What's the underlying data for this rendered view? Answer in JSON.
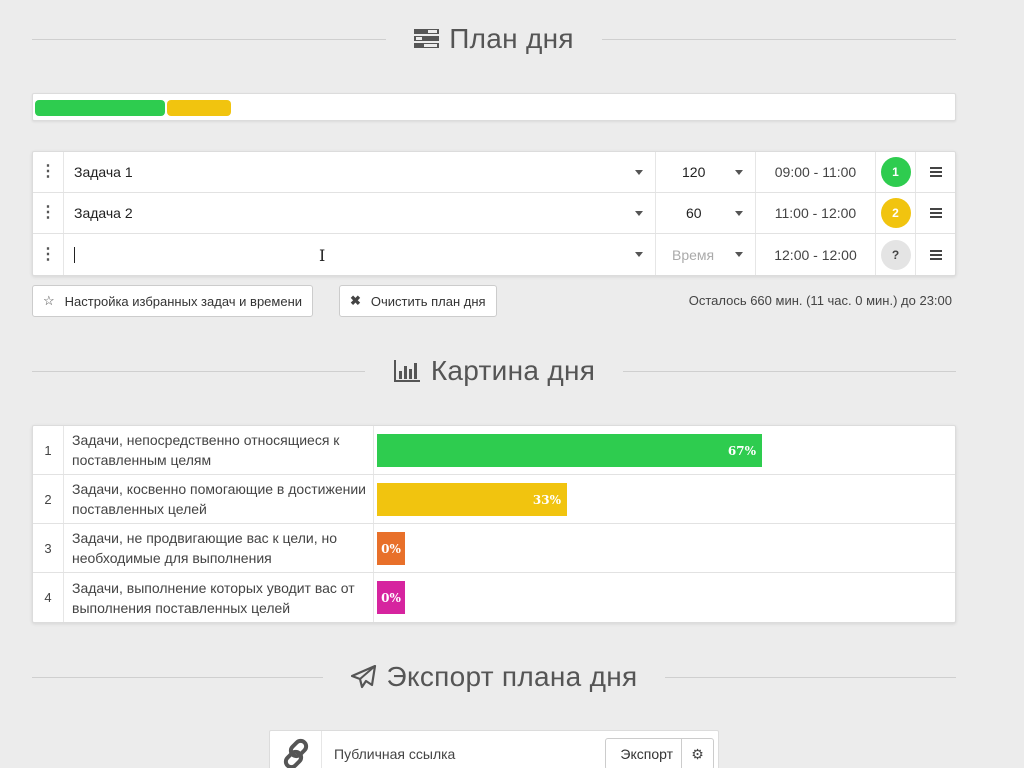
{
  "plan_section": {
    "title": "План дня",
    "icon": "tasks-list-icon"
  },
  "progress": {
    "segments": [
      {
        "name": "task-1",
        "color": "#2ecc4f",
        "fraction": 0.143
      },
      {
        "name": "task-2",
        "color": "#f1c40f",
        "fraction": 0.071
      }
    ]
  },
  "tasks": [
    {
      "name": "Задача 1",
      "duration": "120",
      "time": "09:00 - 11:00",
      "badge": "1",
      "badge_color": "#2ecc4f"
    },
    {
      "name": "Задача 2",
      "duration": "60",
      "time": "11:00 - 12:00",
      "badge": "2",
      "badge_color": "#f1c40f"
    },
    {
      "name": "",
      "duration_placeholder": "Время",
      "time": "12:00 - 12:00",
      "badge": "?",
      "badge_color": "#e4e4e4"
    }
  ],
  "buttons": {
    "favorites": "Настройка избранных задач и времени",
    "clear": "Очистить план дня"
  },
  "remaining": "Осталось 660 мин. (11 час. 0 мин.) до 23:00",
  "picture_section": {
    "title": "Картина дня",
    "icon": "bar-chart-icon"
  },
  "categories": [
    {
      "num": "1",
      "label": "Задачи, непосредственно относящиеся к поставленным целям",
      "percent": 67,
      "value_label": "67%",
      "color": "#2ecc4f"
    },
    {
      "num": "2",
      "label": "Задачи, косвенно помогающие в достижении поставленных целей",
      "percent": 33,
      "value_label": "33%",
      "color": "#f1c40f"
    },
    {
      "num": "3",
      "label": "Задачи, не продвигающие вас к цели, но необходимые для выполнения",
      "percent": 0,
      "value_label": "0%",
      "color": "#e8702a"
    },
    {
      "num": "4",
      "label": "Задачи, выполнение которых уводит вас от выполнения поставленных целей",
      "percent": 0,
      "value_label": "0%",
      "color": "#d6249f"
    }
  ],
  "export_section": {
    "title": "Экспорт плана дня",
    "icon": "paper-plane-icon"
  },
  "export": {
    "label": "Публичная ссылка",
    "button": "Экспорт",
    "link_icon": "link-icon",
    "settings_icon": "gear-icon"
  }
}
